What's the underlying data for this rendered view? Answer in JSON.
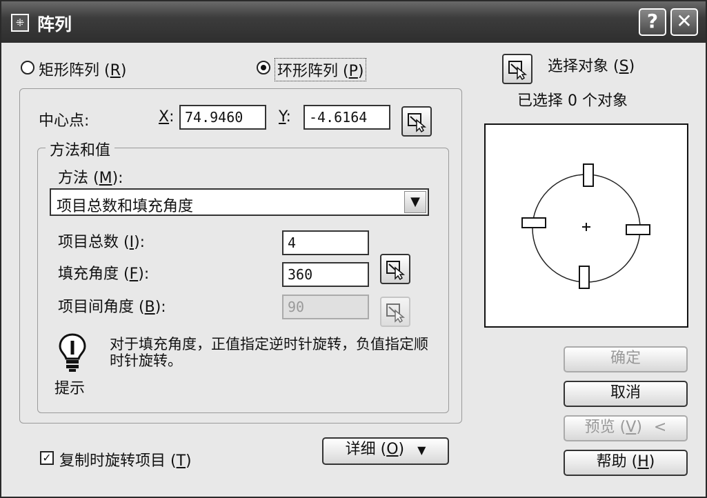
{
  "window": {
    "title": "阵列",
    "help_glyph": "?",
    "close_glyph": "✕"
  },
  "array_type": {
    "rect_label": "矩形阵列",
    "rect_key": "R",
    "polar_label": "环形阵列",
    "polar_key": "P",
    "selected": "polar"
  },
  "select_objects": {
    "button_label": "选择对象",
    "button_key": "S",
    "status": "已选择 0 个对象"
  },
  "center_point": {
    "label": "中心点:",
    "x_label": "X",
    "x_value": "74.9460",
    "y_label": "Y",
    "y_value": "-4.6164"
  },
  "method_group": {
    "legend": "方法和值",
    "method_label": "方法",
    "method_key": "M",
    "method_value": "项目总数和填充角度",
    "total_label": "项目总数",
    "total_key": "I",
    "total_value": "4",
    "fill_label": "填充角度",
    "fill_key": "F",
    "fill_value": "360",
    "between_label": "项目间角度",
    "between_key": "B",
    "between_value": "90"
  },
  "hint": {
    "label": "提示",
    "text": "对于填充角度，正值指定逆时针旋转，负值指定顺时针旋转。"
  },
  "rotate_items": {
    "label": "复制时旋转项目",
    "key": "T",
    "checked": true
  },
  "buttons": {
    "details_label": "详细",
    "details_key": "O",
    "details_arrow": "▼",
    "ok_label": "确定",
    "cancel_label": "取消",
    "preview_label": "预览",
    "preview_key": "V",
    "preview_arrow": "<",
    "help_label": "帮助",
    "help_key": "H"
  },
  "icons": {
    "app": "array-icon",
    "pick": "pick-point-icon",
    "hint": "lightbulb-icon"
  }
}
